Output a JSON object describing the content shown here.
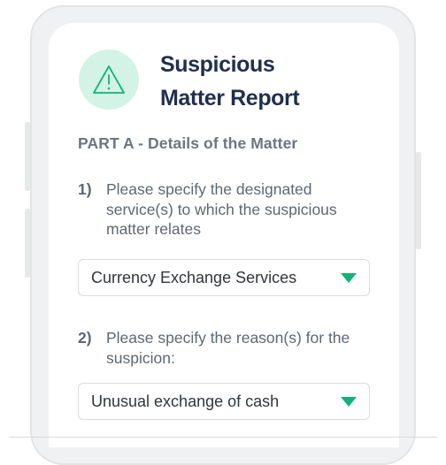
{
  "colors": {
    "accent": "#12b27a",
    "icon_bg": "#d3f3e6",
    "title": "#1f2f4d",
    "text": "#5f6673"
  },
  "header": {
    "icon": "warning-triangle-icon",
    "title_line1": "Suspicious",
    "title_line2": "Matter Report"
  },
  "section": {
    "heading": "PART A - Details of the Matter"
  },
  "questions": [
    {
      "number": "1)",
      "text": "Please specify the designated service(s) to which the suspicious matter relates",
      "selected": "Currency Exchange Services"
    },
    {
      "number": "2)",
      "text": "Please specify the reason(s) for the suspicion:",
      "selected": "Unusual exchange of cash"
    }
  ]
}
